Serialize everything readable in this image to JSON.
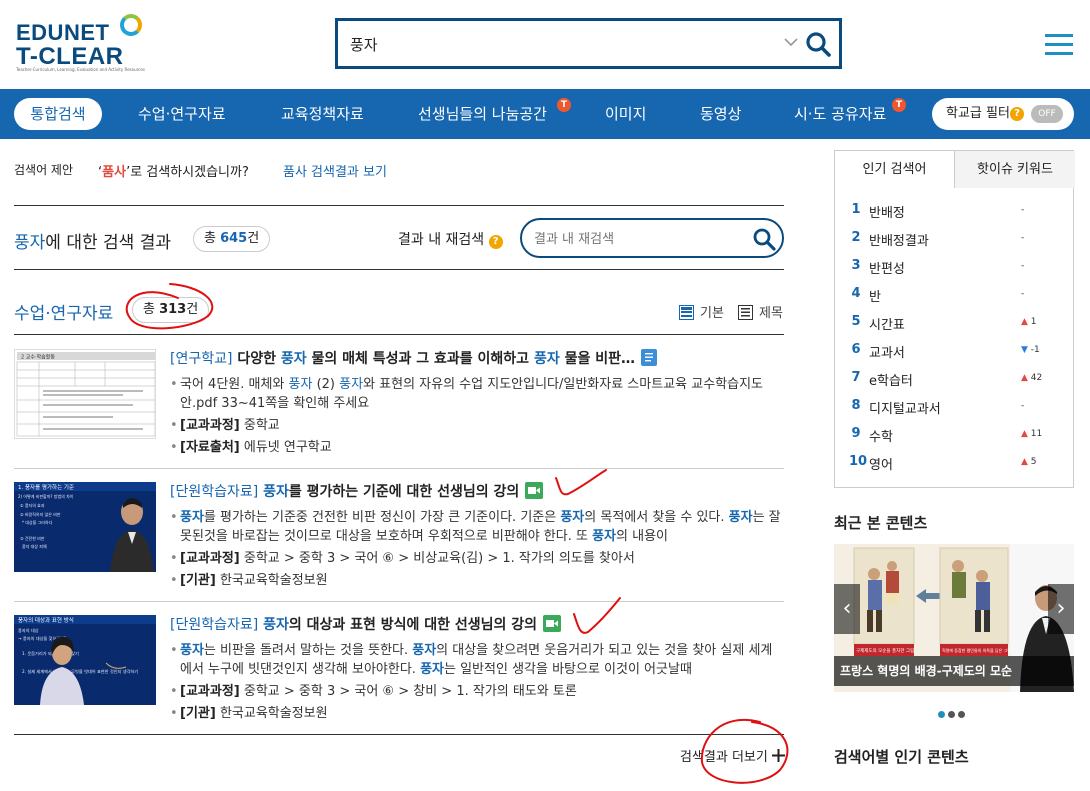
{
  "logo": {
    "line1": "EDUNET",
    "line2": "T-CLEAR",
    "tagline": "Teacher-Curriculum, Learning, Evaluation and Activity Resources"
  },
  "search": {
    "value": "풍자",
    "placeholder": ""
  },
  "nav": {
    "items": [
      {
        "label": "통합검색",
        "active": true
      },
      {
        "label": "수업·연구자료"
      },
      {
        "label": "교육정책자료"
      },
      {
        "label": "선생님들의 나눔공간",
        "badge": "T"
      },
      {
        "label": "이미지"
      },
      {
        "label": "동영상"
      },
      {
        "label": "시·도 공유자료",
        "badge": "T"
      }
    ],
    "filter_label": "학교급 필터",
    "filter_help": "?",
    "filter_state": "OFF"
  },
  "suggest": {
    "label": "검색어 제안",
    "quote_open": "‘",
    "suggested_word": "품사",
    "quote_rest": "’로 검색하시겠습니까?",
    "link": "품사 검색결과 보기"
  },
  "summary": {
    "keyword": "풍자",
    "suffix": "에 대한 검색 결과",
    "total_prefix": "총 ",
    "total_count": "645",
    "total_unit": "건",
    "research_label": "결과 내 재검색",
    "research_help": "?",
    "research_placeholder": "결과 내 재검색"
  },
  "section": {
    "title": "수업·연구자료",
    "count_prefix": "총 ",
    "count": "313",
    "count_unit": "건",
    "view_basic": "기본",
    "view_title": "제목"
  },
  "results": [
    {
      "category": "[연구학교]",
      "title_parts": [
        " 다양한 ",
        "풍자",
        " 물의 매체 특성과 그 효과를 이해하고 ",
        "풍자",
        " 물을 비판…"
      ],
      "type_icon": "document-icon",
      "desc_parts": [
        "국어 4단원. 매체와 ",
        "풍자",
        " (2) ",
        "풍자",
        "와 표현의 자유의 수업 지도안입니다/일반화자료 스마트교육 교수학습지도안.pdf 33~41쪽을 확인해 주세요"
      ],
      "meta": [
        {
          "label": "[교과과정]",
          "value": " 중학교"
        },
        {
          "label": "[자료출처]",
          "value": " 에듀넷 연구학교"
        }
      ]
    },
    {
      "category": "[단원학습자료]",
      "title_parts": [
        " ",
        "풍자",
        "를 평가하는 기준에 대한 선생님의 강의"
      ],
      "type_icon": "video-icon",
      "desc_parts": [
        "",
        "풍자",
        "를 평가하는 기준중 건전한 비판 정신이 가장 큰 기준이다. 기준은 ",
        "풍자",
        "의 목적에서 찾을 수 있다. ",
        "풍자",
        "는 잘못된것을 바로잡는 것이므로 대상을 보호하며 우회적으로 비판해야 한다. 또 ",
        "풍자",
        "의 내용이"
      ],
      "meta": [
        {
          "label": "[교과과정]",
          "value": " 중학교 > 중학 3 > 국어 ⑥ > 비상교육(김) > 1. 작가의 의도를 찾아서"
        },
        {
          "label": "[기관]",
          "value": " 한국교육학술정보원"
        }
      ]
    },
    {
      "category": "[단원학습자료]",
      "title_parts": [
        " ",
        "풍자",
        "의 대상과 표현 방식에 대한 선생님의 강의"
      ],
      "type_icon": "video-icon",
      "desc_parts": [
        "",
        "풍자",
        "는 비판을 돌려서 말하는 것을 뜻한다. ",
        "풍자",
        "의 대상을 찾으려면 웃음거리가 되고 있는 것을 찾아 실제 세계에서 누구에 빗댄것인지 생각해 보아야한다. ",
        "풍자",
        "는 일반적인 생각을 바탕으로 이것이 어긋날때"
      ],
      "meta": [
        {
          "label": "[교과과정]",
          "value": " 중학교 > 중학 3 > 국어 ⑥ > 창비 > 1. 작가의 태도와 토론"
        },
        {
          "label": "[기관]",
          "value": " 한국교육학술정보원"
        }
      ]
    }
  ],
  "thumbs": {
    "t1_heading": "2 교수·학습활동",
    "t2_heading": "1. 풍자를 평가하는 기준",
    "t2_lines": [
      "2) 어떻게 비판할까? 방법의 차이",
      "① 풍자의 효과",
      "② 바람직하지 않은 비판",
      "* 대상을 그러하다",
      "③ 건전한 비판",
      "풍자 대상 피해"
    ],
    "t3_heading": "풍자의 대상과 표현 방식",
    "t3_lines": [
      "풍자의 대상",
      "→ 풍자의 대상을 찾으려면?",
      "1. 웃음거리가 되고 있는 것 찾기",
      "2. 실제 세계에서 누구 혹은 무엇을 빗대어 표현한 것인지 생각하기"
    ]
  },
  "more": {
    "label": "검색결과 더보기",
    "icon": "plus-icon"
  },
  "sidebar": {
    "tab_popular": "인기 검색어",
    "tab_hot": "핫이슈 키워드",
    "ranks": [
      {
        "n": "1",
        "word": "반배정",
        "trend": "-",
        "dir": "none"
      },
      {
        "n": "2",
        "word": "반배정결과",
        "trend": "-",
        "dir": "none"
      },
      {
        "n": "3",
        "word": "반편성",
        "trend": "-",
        "dir": "none"
      },
      {
        "n": "4",
        "word": "반",
        "trend": "-",
        "dir": "none"
      },
      {
        "n": "5",
        "word": "시간표",
        "trend": "1",
        "dir": "up"
      },
      {
        "n": "6",
        "word": "교과서",
        "trend": "-1",
        "dir": "down"
      },
      {
        "n": "7",
        "word": "e학습터",
        "trend": "42",
        "dir": "up"
      },
      {
        "n": "8",
        "word": "디지털교과서",
        "trend": "-",
        "dir": "none"
      },
      {
        "n": "9",
        "word": "수학",
        "trend": "11",
        "dir": "up"
      },
      {
        "n": "10",
        "word": "영어",
        "trend": "5",
        "dir": "up"
      }
    ],
    "recent_title": "최근 본 콘텐츠",
    "carousel_caption": "프랑스 혁명의 배경-구제도의 모순",
    "carousel_img_left": "구제제도의 모순을 풍자한 그림",
    "carousel_img_right": "혁명에 동참한 평민들의 의욕을 담은 그림",
    "popular_by_keyword": "검색어별 인기 콘텐츠"
  },
  "colors": {
    "brand": "#1666b0",
    "dark": "#0b4a7d",
    "accent": "#f2a400",
    "badge": "#f0572d",
    "annotation": "#e01010"
  }
}
